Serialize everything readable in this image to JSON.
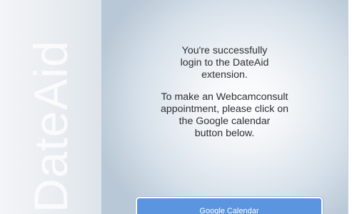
{
  "sidebar": {
    "brand_text": "DateAid"
  },
  "main": {
    "success_message_lines": [
      "You're successfully",
      "login to the DateAid",
      "extension."
    ],
    "instruction_lines": [
      "To make an Webcamconsult",
      "appointment, please click on",
      "the Google calendar",
      "button below."
    ],
    "calendar_button_label": "Google Calendar"
  },
  "colors": {
    "button_background": "#5b95df",
    "text": "#2b2f33",
    "sidebar_background": "#e9edf1"
  }
}
